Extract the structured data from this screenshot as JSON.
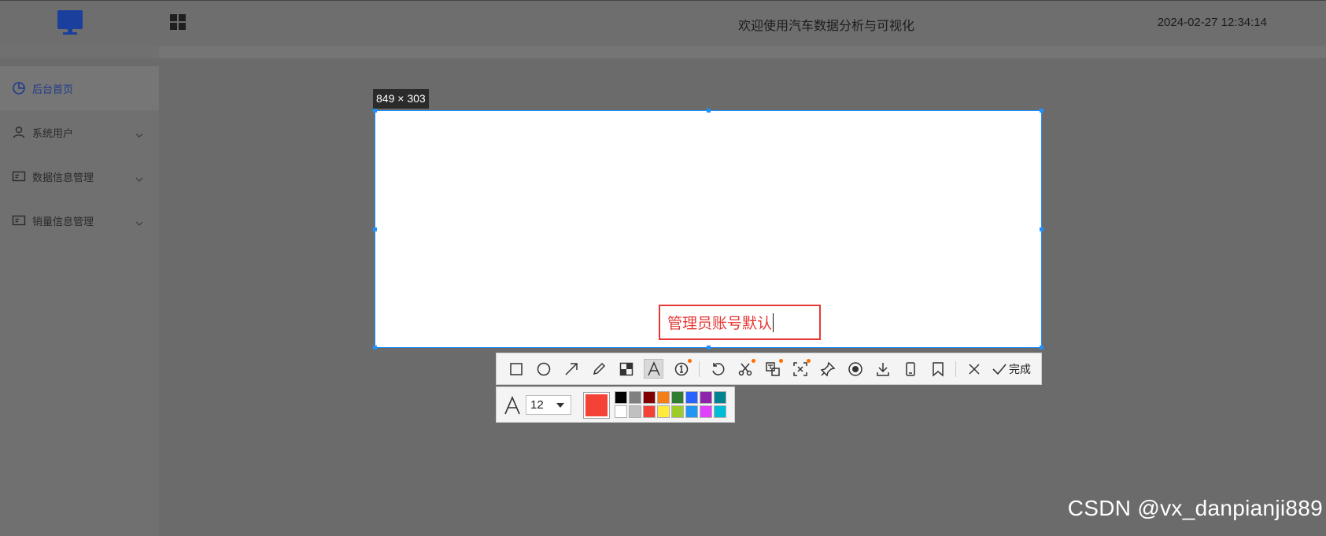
{
  "app": {
    "title": "欢迎使用汽车数据分析与可视化",
    "datetime": "2024-02-27 12:34:14"
  },
  "sidebar": {
    "items": [
      {
        "label": "后台首页",
        "icon": "pie-chart-icon",
        "active": true
      },
      {
        "label": "系统用户",
        "icon": "user-icon",
        "expandable": true
      },
      {
        "label": "数据信息管理",
        "icon": "card-icon",
        "expandable": true
      },
      {
        "label": "销量信息管理",
        "icon": "card-icon",
        "expandable": true
      }
    ]
  },
  "capture": {
    "size_label": "849 × 303",
    "annotation_text": "管理员账号默认",
    "annotation_color": "#e53935",
    "border_color": "#1e90ff"
  },
  "toolbar": {
    "tools": [
      "rectangle-icon",
      "ellipse-icon",
      "arrow-icon",
      "pencil-icon",
      "mosaic-icon",
      "text-icon",
      "number-marker-icon",
      "undo-icon",
      "scissors-icon",
      "translate-icon",
      "ocr-icon",
      "pin-icon",
      "record-icon",
      "download-icon",
      "phone-icon",
      "bookmark-icon",
      "close-icon"
    ],
    "active_tool": "text-icon",
    "done_label": "完成"
  },
  "text_options": {
    "font_size": "12",
    "current_color": "#f44336",
    "palette": [
      "#000000",
      "#808080",
      "#800000",
      "#f57f17",
      "#2e7d32",
      "#2962ff",
      "#8e24aa",
      "#00838f",
      "#ffffff",
      "#c0c0c0",
      "#f44336",
      "#ffeb3b",
      "#9ccc28",
      "#2196f3",
      "#e040fb",
      "#00bcd4"
    ]
  },
  "watermark": "CSDN @vx_danpianji889"
}
